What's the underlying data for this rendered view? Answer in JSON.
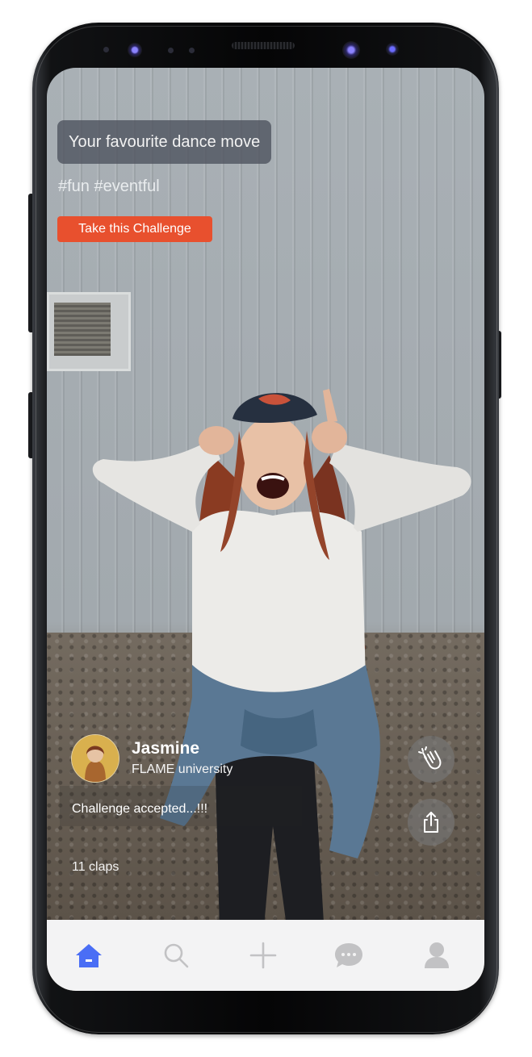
{
  "challenge": {
    "title": "Your favourite dance move",
    "hashtags": "#fun #eventful",
    "cta_label": "Take this Challenge",
    "cta_color": "#e8502e"
  },
  "post": {
    "user_name": "Jasmine",
    "user_org": "FLAME university",
    "caption": "Challenge accepted...!!!",
    "claps": "11 claps"
  },
  "actions": [
    {
      "icon": "clap-icon"
    },
    {
      "icon": "share-icon"
    }
  ],
  "nav": {
    "items": [
      {
        "icon": "home-icon",
        "active": true
      },
      {
        "icon": "search-icon",
        "active": false
      },
      {
        "icon": "plus-icon",
        "active": false
      },
      {
        "icon": "chat-icon",
        "active": false
      },
      {
        "icon": "profile-icon",
        "active": false
      }
    ],
    "active_color": "#4a6ef5",
    "inactive_color": "#c2c2c4"
  }
}
